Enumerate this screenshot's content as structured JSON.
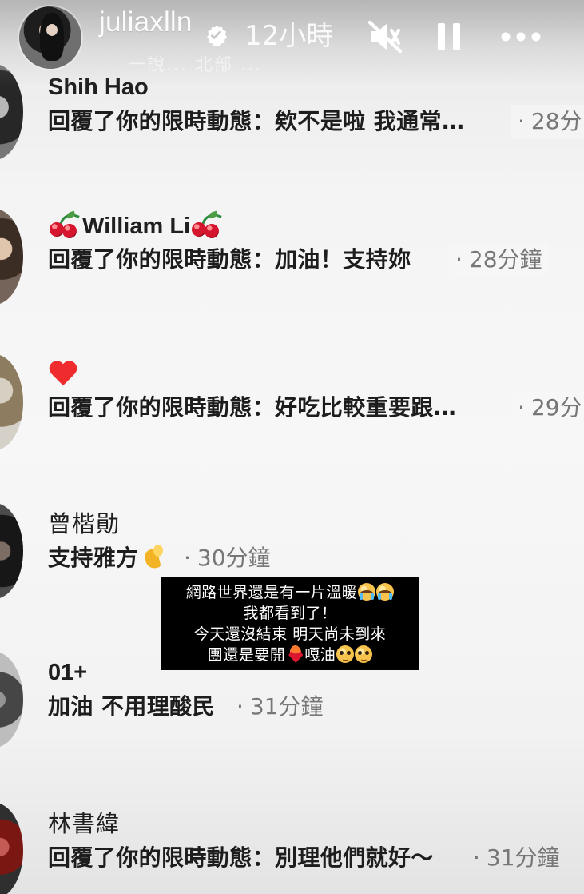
{
  "header": {
    "username": "juliaxlln",
    "time_ago": "12小時",
    "partial_caption": "一說... 北部 ...",
    "icons": {
      "verified": "verified-badge-icon",
      "mute": "speaker-muted-icon",
      "pause": "pause-icon",
      "more": "more-dots-icon"
    }
  },
  "notifications": [
    {
      "name": "Shih Hao",
      "message": "回覆了你的限時動態：欸不是啦 我通常…",
      "timestamp": "28分"
    },
    {
      "name": "William Li",
      "message": "回覆了你的限時動態：加油！支持妳",
      "timestamp": "28分鐘"
    },
    {
      "name": "",
      "message": "回覆了你的限時動態：好吃比較重要跟…",
      "timestamp": "29分"
    },
    {
      "name": "曾楷勛",
      "message": "支持雅方",
      "timestamp": "30分鐘"
    },
    {
      "name": "01+",
      "message": "加油 不用理酸民",
      "timestamp": "31分鐘"
    },
    {
      "name": "林書緯",
      "message": "回覆了你的限時動態：別理他們就好～",
      "timestamp": "31分鐘"
    }
  ],
  "caption": {
    "line1": "網路世界還是有一片溫暖",
    "line2": "我都看到了！",
    "line3": "今天還沒結束 明天尚未到來",
    "line4a": "團還是要開",
    "line4b": "嘎油"
  },
  "colors": {
    "story_text": "#ffffff",
    "primary_text": "#1d1d1d",
    "secondary_text": "#777777",
    "caption_background": "#000000",
    "cherry_red": "#d5162e",
    "heart_red": "#ef2b2d"
  },
  "dot": "·"
}
